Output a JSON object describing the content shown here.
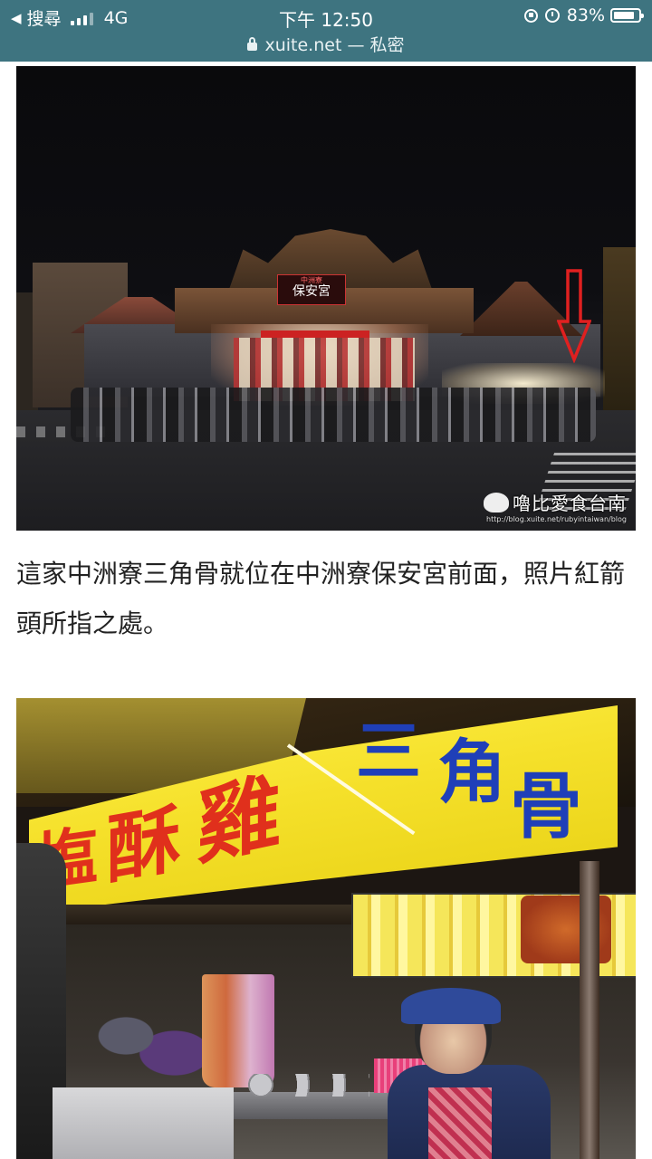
{
  "status_bar": {
    "back_app": "搜尋",
    "network": "4G",
    "time": "下午 12:50",
    "battery": "83%",
    "battery_level": 0.83
  },
  "url_bar": {
    "domain": "xuite.net",
    "separator": " — ",
    "mode": "私密"
  },
  "photo1": {
    "temple_sign_small": "中洲寮",
    "temple_sign": "保安宮",
    "watermark_brand": "嚕比愛食台南",
    "watermark_url": "http://blog.xuite.net/rubyintaiwan/blog",
    "arrow_color": "#e02020"
  },
  "caption": {
    "text": "這家中洲寮三角骨就位在中洲寮保安宮前面，照片紅箭頭所指之處。"
  },
  "photo2": {
    "sign_red": [
      "塩",
      "酥",
      "雞"
    ],
    "sign_blue": [
      "三",
      "角",
      "骨"
    ],
    "sign_color": "#f5e02a",
    "red_text_color": "#e0301c",
    "blue_text_color": "#1f3fb8"
  },
  "colors": {
    "status_bar_bg": "#3e7480"
  }
}
